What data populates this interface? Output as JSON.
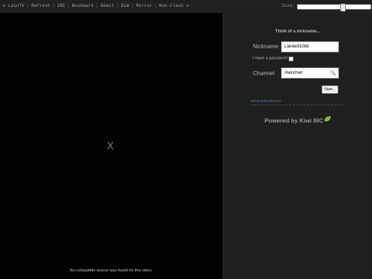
{
  "nav": {
    "items": [
      "« LainTV",
      "Refresh",
      "IRC",
      "Bookmark",
      "Email",
      "Dim",
      "Mirror",
      "Non-Flash »"
    ],
    "size_label": "Size:",
    "size_value": 0.62
  },
  "video": {
    "close_glyph": "X",
    "message": "No compatible source was found for this video."
  },
  "kiwi": {
    "heading": "Think of a nickname...",
    "nickname_label": "Nickname",
    "nickname_value": "Lainite91068",
    "password_label": "I have a password",
    "channel_label": "Channel",
    "channel_value": "#lainchan",
    "start_label": "Start...",
    "server_link": "Server and network ▾",
    "powered_by": "Powered by Kiwi IRC",
    "accent_color": "#8bc34a"
  }
}
